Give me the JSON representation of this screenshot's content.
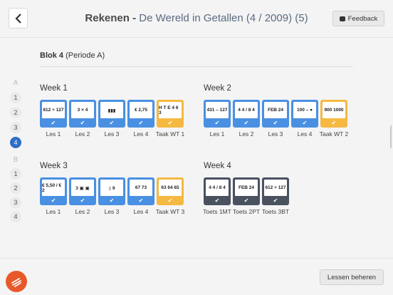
{
  "header": {
    "title_bold": "Rekenen - ",
    "title_rest": "De Wereld in Getallen (4 / 2009) (5)",
    "feedback_label": "Feedback"
  },
  "block": {
    "name": "Blok 4",
    "period": "(Periode A)"
  },
  "side_nav": {
    "group_a": "A",
    "group_a_items": [
      "1",
      "2",
      "3",
      "4"
    ],
    "active_item": "4",
    "group_b": "B",
    "group_b_items": [
      "1",
      "2",
      "3",
      "4"
    ]
  },
  "weeks": [
    {
      "title": "Week 1",
      "tiles": [
        {
          "label": "Les 1",
          "face": "612 + 127",
          "color": "blue"
        },
        {
          "label": "Les 2",
          "face": "3 × 4",
          "color": "blue"
        },
        {
          "label": "Les 3",
          "face": "▮▮▮",
          "color": "blue"
        },
        {
          "label": "Les 4",
          "face": "€ 2,75",
          "color": "blue"
        },
        {
          "label": "Taak WT 1",
          "face": "H T E 4 6 3",
          "color": "orange"
        }
      ]
    },
    {
      "title": "Week 2",
      "tiles": [
        {
          "label": "Les 1",
          "face": "431 – 127",
          "color": "blue"
        },
        {
          "label": "Les 2",
          "face": "4 4 / 8 4",
          "color": "blue"
        },
        {
          "label": "Les 3",
          "face": "FEB 24",
          "color": "blue"
        },
        {
          "label": "Les 4",
          "face": "100 – ●",
          "color": "blue"
        },
        {
          "label": "Taak WT 2",
          "face": "900 1000",
          "color": "orange"
        }
      ]
    },
    {
      "title": "Week 3",
      "tiles": [
        {
          "label": "Les 1",
          "face": "€ 5,50 / € 2",
          "color": "blue"
        },
        {
          "label": "Les 2",
          "face": "3 ▣ ▣",
          "color": "blue"
        },
        {
          "label": "Les 3",
          "face": "▯ 9",
          "color": "blue"
        },
        {
          "label": "Les 4",
          "face": "67 73",
          "color": "blue"
        },
        {
          "label": "Taak WT 3",
          "face": "63 64 65",
          "color": "orange"
        }
      ]
    },
    {
      "title": "Week 4",
      "tiles": [
        {
          "label": "Toets 1MT",
          "face": "4 4 / 8 4",
          "color": "dark"
        },
        {
          "label": "Toets 2PT",
          "face": "FEB 24",
          "color": "dark"
        },
        {
          "label": "Toets 3BT",
          "face": "612 + 127",
          "color": "dark"
        }
      ]
    }
  ],
  "footer": {
    "manage_label": "Lessen beheren"
  },
  "colors": {
    "accent": "#2d6fc8",
    "lesson_tile": "#4a90e2",
    "task_tile": "#f5b942",
    "test_tile": "#4a5260",
    "logo": "#e8592a"
  },
  "icons": {
    "check": "✔",
    "back": "chevron-left-icon",
    "feedback": "speech-bubble-icon"
  }
}
